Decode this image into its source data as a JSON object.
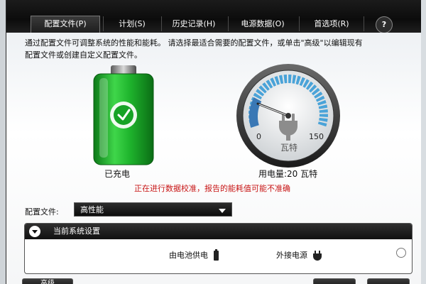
{
  "tabs": [
    {
      "label": "配置文件(P)",
      "active": true
    },
    {
      "label": "计划(S)",
      "active": false
    },
    {
      "label": "历史记录(H)",
      "active": false
    },
    {
      "label": "电源数据(O)",
      "active": false
    },
    {
      "label": "首选项(R)",
      "active": false
    }
  ],
  "help_label": "?",
  "description": {
    "line1": "通过配置文件可调整系统的性能和能耗。 请选择最适合需要的配置文件，或单击\"高级\"以编辑现有",
    "line2": "配置文件或创建自定义配置文件。"
  },
  "battery": {
    "status_label": "已充电",
    "body_color": "#1fb52d"
  },
  "gauge": {
    "min_label": "0",
    "max_label": "150",
    "unit_label": "瓦特",
    "usage_label": "用电量:20 瓦特",
    "value": 20,
    "max": 150,
    "accent": "#4aa3d8"
  },
  "warning_text": "正在进行数据校准，报告的能耗值可能不准确",
  "profile": {
    "label": "配置文件:",
    "selected": "高性能"
  },
  "current_settings": {
    "title": "当前系统设置",
    "col_battery": "由电池供电",
    "col_ac": "外接电源"
  },
  "advanced_label": "高级"
}
